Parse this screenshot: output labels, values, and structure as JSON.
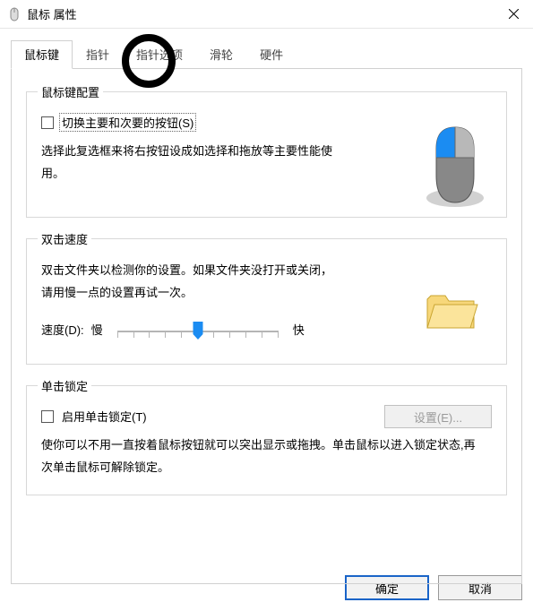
{
  "window": {
    "title": "鼠标 属性"
  },
  "tabs": [
    {
      "label": "鼠标键",
      "active": true
    },
    {
      "label": "指针",
      "active": false
    },
    {
      "label": "指针选项",
      "active": false
    },
    {
      "label": "滑轮",
      "active": false
    },
    {
      "label": "硬件",
      "active": false
    }
  ],
  "group1": {
    "legend": "鼠标键配置",
    "checkbox_label": "切换主要和次要的按钮(S)",
    "desc": "选择此复选框来将右按钮设成如选择和拖放等主要性能使用。"
  },
  "group2": {
    "legend": "双击速度",
    "desc": "双击文件夹以检测你的设置。如果文件夹没打开或关闭，请用慢一点的设置再试一次。",
    "speed_label": "速度(D):",
    "slow": "慢",
    "fast": "快"
  },
  "group3": {
    "legend": "单击锁定",
    "checkbox_label": "启用单击锁定(T)",
    "settings_btn": "设置(E)...",
    "desc": "使你可以不用一直按着鼠标按钮就可以突出显示或拖拽。单击鼠标以进入锁定状态,再次单击鼠标可解除锁定。"
  },
  "buttons": {
    "ok": "确定",
    "cancel": "取消"
  }
}
